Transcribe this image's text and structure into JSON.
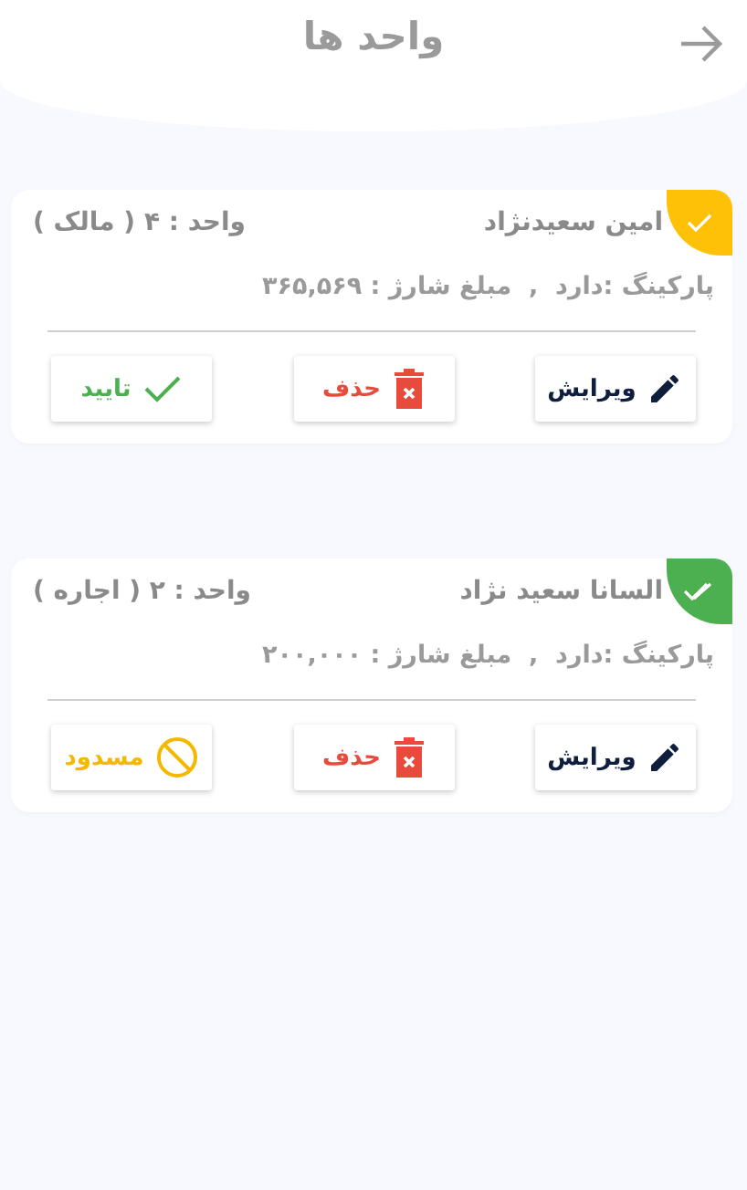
{
  "header": {
    "title": "واحد ها"
  },
  "units": [
    {
      "name": "امین سعیدنژاد",
      "unit": "واحد : ۴ ( مالک )",
      "details": "پارکینگ :دارد  ,  مبلغ شارژ : ۳۶۵,۵۶۹",
      "approved": false,
      "actions": [
        {
          "kind": "edit",
          "label": "ویرایش"
        },
        {
          "kind": "delete",
          "label": "حذف"
        },
        {
          "kind": "approve",
          "label": "تایید"
        }
      ]
    },
    {
      "name": "السانا سعید نژاد",
      "unit": "واحد : ۲ ( اجاره )",
      "details": "پارکینگ :دارد  ,  مبلغ شارژ : ۲۰۰,۰۰۰",
      "approved": true,
      "actions": [
        {
          "kind": "edit",
          "label": "ویرایش"
        },
        {
          "kind": "delete",
          "label": "حذف"
        },
        {
          "kind": "block",
          "label": "مسدود"
        }
      ]
    }
  ]
}
